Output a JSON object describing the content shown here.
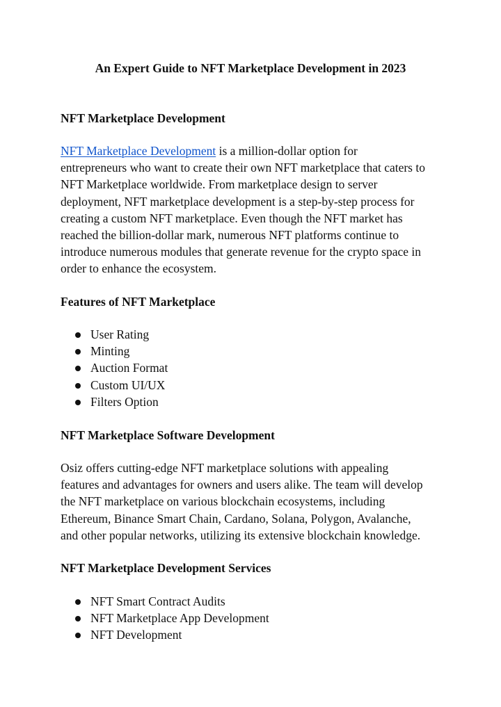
{
  "document": {
    "title": "An Expert Guide to NFT  Marketplace Development in 2023",
    "sections": [
      {
        "heading": "NFT Marketplace Development",
        "paragraph": {
          "link_text": "NFT Marketplace Development",
          "lines": [
            " is a million-dollar option for",
            "entrepreneurs who want to create their own NFT marketplace that caters to",
            "NFT Marketplace worldwide. From marketplace design to server",
            "deployment, NFT marketplace development is a step-by-step process for",
            "creating a custom NFT marketplace. Even though the NFT market has",
            "reached the billion-dollar mark, numerous NFT platforms continue to",
            "introduce numerous modules that generate revenue for the crypto space in",
            "order to enhance the ecosystem."
          ]
        }
      },
      {
        "heading": "Features of NFT Marketplace",
        "bullets": [
          "User Rating",
          "Minting",
          "Auction Format",
          "Custom UI/UX",
          "Filters Option"
        ]
      },
      {
        "heading": "NFT Marketplace Software Development",
        "paragraph": {
          "lines": [
            "Osiz offers cutting-edge NFT marketplace solutions with appealing",
            "features and advantages for owners and users alike. The team will develop",
            "the NFT marketplace on various blockchain ecosystems, including",
            "Ethereum, Binance Smart Chain, Cardano, Solana, Polygon, Avalanche,",
            "and other popular networks, utilizing its extensive blockchain knowledge."
          ]
        }
      },
      {
        "heading": "NFT Marketplace Development Services",
        "bullets": [
          "NFT Smart Contract Audits",
          "NFT Marketplace App Development",
          "NFT Development"
        ]
      }
    ]
  },
  "colors": {
    "link": "#1155cc",
    "text": "#111111",
    "background": "#ffffff"
  }
}
